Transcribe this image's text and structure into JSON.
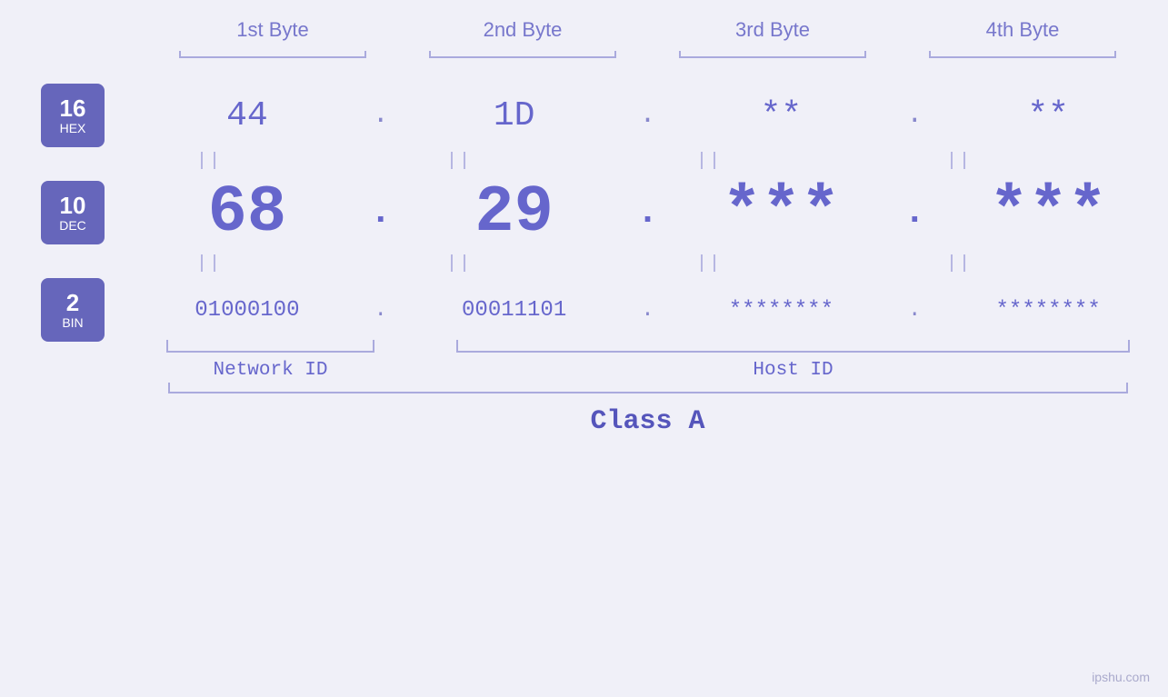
{
  "headers": {
    "byte1": "1st Byte",
    "byte2": "2nd Byte",
    "byte3": "3rd Byte",
    "byte4": "4th Byte"
  },
  "rows": {
    "hex": {
      "label_num": "16",
      "label_base": "HEX",
      "values": [
        "44",
        "1D",
        "**",
        "**"
      ],
      "dots": [
        ".",
        ".",
        ".",
        ""
      ]
    },
    "dec": {
      "label_num": "10",
      "label_base": "DEC",
      "values": [
        "68",
        "29",
        "***",
        "***"
      ],
      "dots": [
        ".",
        ".",
        ".",
        ""
      ]
    },
    "bin": {
      "label_num": "2",
      "label_base": "BIN",
      "values": [
        "01000100",
        "00011101",
        "********",
        "********"
      ],
      "dots": [
        ".",
        ".",
        ".",
        ""
      ]
    }
  },
  "labels": {
    "network_id": "Network ID",
    "host_id": "Host ID",
    "class": "Class A"
  },
  "watermark": "ipshu.com"
}
